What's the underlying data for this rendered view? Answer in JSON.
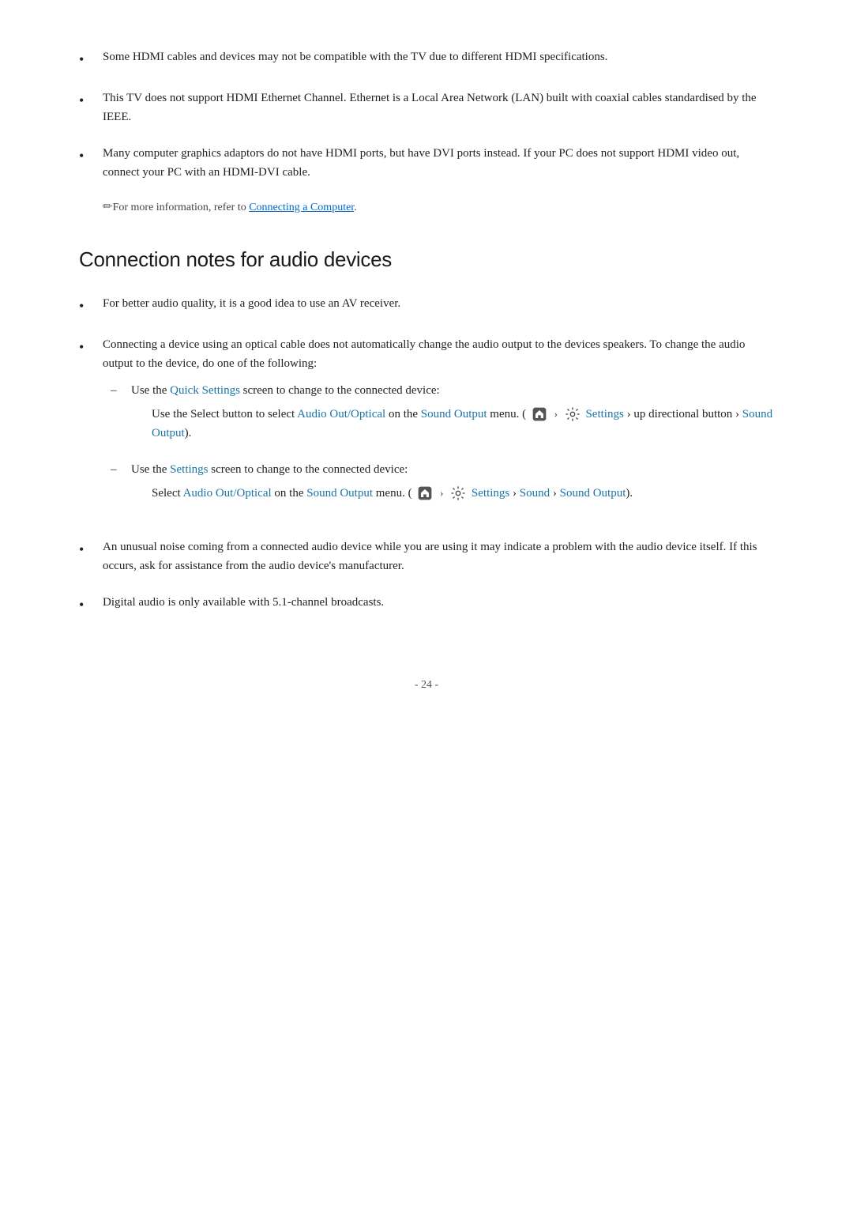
{
  "bullets_top": [
    {
      "id": "hdmi-compat",
      "text": "Some HDMI cables and devices may not be compatible with the TV due to different HDMI specifications."
    },
    {
      "id": "hdmi-ethernet",
      "text": "This TV does not support HDMI Ethernet Channel. Ethernet is a Local Area Network (LAN) built with coaxial cables standardised by the IEEE."
    },
    {
      "id": "hdmi-dvi",
      "text": "Many computer graphics adaptors do not have HDMI ports, but have DVI ports instead. If your PC does not support HDMI video out, connect your PC with an HDMI-DVI cable."
    }
  ],
  "note": {
    "text": "For more information, refer to ",
    "link_text": "Connecting a Computer",
    "text_after": "."
  },
  "section_title": "Connection notes for audio devices",
  "audio_bullets": [
    {
      "id": "av-receiver",
      "text": "For better audio quality, it is a good idea to use an AV receiver."
    },
    {
      "id": "optical-cable",
      "text": "Connecting a device using an optical cable does not automatically change the audio output to the devices speakers. To change the audio output to the device, do one of the following:",
      "sub_items": [
        {
          "id": "quick-settings",
          "intro": "Use the ",
          "intro_link": "Quick Settings",
          "intro_rest": " screen to change to the connected device:",
          "indented": {
            "pre": "Use the Select button to select ",
            "link1": "Audio Out/Optical",
            "mid1": " on the ",
            "link2": "Sound Output",
            "mid2": " menu. (",
            "icon_home": true,
            "post_home": " › ",
            "icon_settings": true,
            "link3": "Settings",
            "post3": " › up directional button › ",
            "link4": "Sound Output",
            "end": ")."
          }
        },
        {
          "id": "settings-screen",
          "intro": "Use the ",
          "intro_link": "Settings",
          "intro_rest": " screen to change to the connected device:",
          "indented": {
            "pre": "Select ",
            "link1": "Audio Out/Optical",
            "mid1": " on the ",
            "link2": "Sound Output",
            "mid2": " menu. (",
            "icon_home": true,
            "post_home": " › ",
            "icon_settings": true,
            "link3": "Settings",
            "post3": " › ",
            "link4": "Sound",
            "post4": " › ",
            "link5": "Sound Output",
            "end": ")."
          }
        }
      ]
    },
    {
      "id": "unusual-noise",
      "text": "An unusual noise coming from a connected audio device while you are using it may indicate a problem with the audio device itself. If this occurs, ask for assistance from the audio device's manufacturer."
    },
    {
      "id": "digital-audio",
      "text": "Digital audio is only available with 5.1-channel broadcasts."
    }
  ],
  "page_number": "- 24 -",
  "labels": {
    "quick_settings": "Quick Settings",
    "audio_out_optical": "Audio Out/Optical",
    "sound_output": "Sound Output",
    "settings": "Settings",
    "up_directional": "up directional button",
    "sound": "Sound",
    "connecting_computer": "Connecting a Computer"
  }
}
